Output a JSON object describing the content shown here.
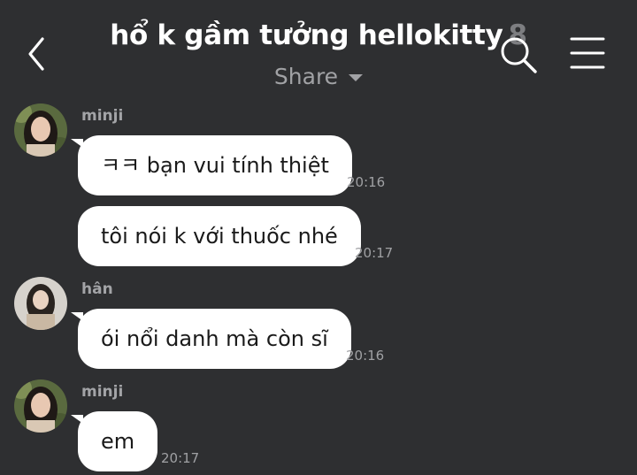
{
  "header": {
    "title": "hổ k gầm tưởng hellokitty",
    "member_count": "8",
    "share_label": "Share"
  },
  "messages": [
    {
      "sender": "minji",
      "text": "ㅋㅋ bạn vui tính thiệt",
      "time": "20:16"
    },
    {
      "sender": "",
      "text": "tôi nói k với thuốc nhé",
      "time": "20:17"
    },
    {
      "sender": "hân",
      "text": "ói nổi danh mà còn sĩ",
      "time": "20:16"
    },
    {
      "sender": "minji",
      "text": "em",
      "time": "20:17"
    }
  ],
  "colors": {
    "background": "#2e2f31",
    "bubble": "#ffffff",
    "muted_text": "#a1a2a5"
  },
  "icons": [
    "back-chevron-icon",
    "search-icon",
    "menu-icon",
    "caret-down-icon"
  ]
}
